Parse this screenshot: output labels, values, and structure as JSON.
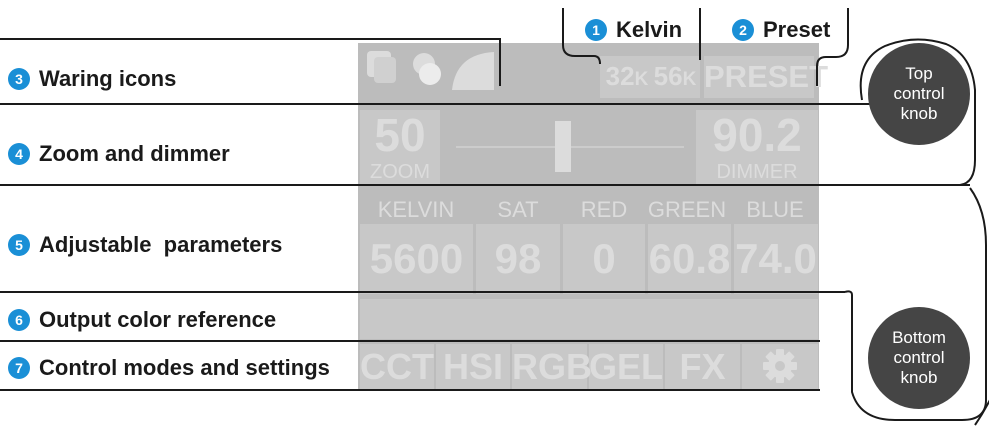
{
  "colors": {
    "badge": "#1a8fd6",
    "panel": "#bcbcbc",
    "cell": "#c8c8c8",
    "ghost_text": "#dcdcdc",
    "line": "#1a1a1a",
    "knob": "#454545"
  },
  "callouts": {
    "kelvin": {
      "num": "1",
      "label": "Kelvin"
    },
    "preset": {
      "num": "2",
      "label": "Preset"
    },
    "warning": {
      "num": "3",
      "label": "Waring icons"
    },
    "zoom_dimmer": {
      "num": "4",
      "label": "Zoom and dimmer"
    },
    "params": {
      "num": "5",
      "label": "Adjustable  parameters"
    },
    "output": {
      "num": "6",
      "label": "Output color reference"
    },
    "modes": {
      "num": "7",
      "label": "Control modes and settings"
    }
  },
  "knobs": {
    "top": [
      "Top",
      "control",
      "knob"
    ],
    "bottom": [
      "Bottom",
      "control",
      "knob"
    ]
  },
  "screen": {
    "status_icons": [
      "square-icon",
      "overlap-circles-icon",
      "arc-icon"
    ],
    "kelvin_buttons": [
      {
        "num": "32",
        "unit": "K"
      },
      {
        "num": "56",
        "unit": "K"
      }
    ],
    "preset_button": "PRESET",
    "zoom": {
      "value": "50",
      "label": "ZOOM"
    },
    "dimmer": {
      "value": "90.2",
      "label": "DIMMER"
    },
    "slider_level": 0.47,
    "param_headers": [
      "KELVIN",
      "SAT",
      "RED",
      "GREEN",
      "BLUE"
    ],
    "param_values": [
      "5600",
      "98",
      "0",
      "60.8",
      "74.0"
    ],
    "modes": [
      "CCT",
      "HSI",
      "RGB",
      "GEL",
      "FX"
    ],
    "settings_icon": "gear-icon"
  }
}
